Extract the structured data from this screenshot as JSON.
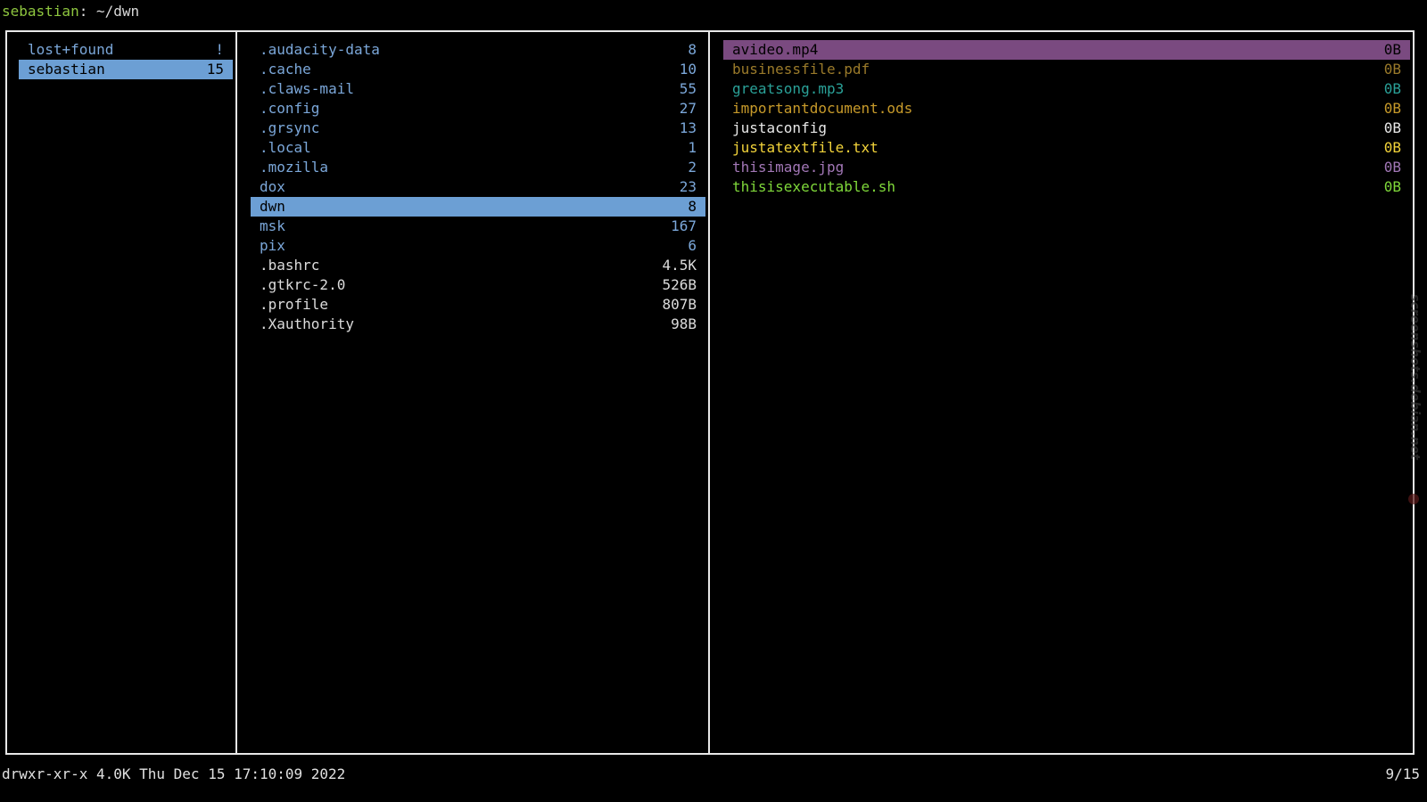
{
  "title": {
    "user": "sebastian",
    "separator": ": ",
    "path": "~/dwn"
  },
  "parent_pane": {
    "items": [
      {
        "name": "lost+found",
        "size": "!"
      },
      {
        "name": "sebastian",
        "size": "15"
      }
    ]
  },
  "current_pane": {
    "items": [
      {
        "name": ".audacity-data",
        "size": "8"
      },
      {
        "name": ".cache",
        "size": "10"
      },
      {
        "name": ".claws-mail",
        "size": "55"
      },
      {
        "name": ".config",
        "size": "27"
      },
      {
        "name": ".grsync",
        "size": "13"
      },
      {
        "name": ".local",
        "size": "1"
      },
      {
        "name": ".mozilla",
        "size": "2"
      },
      {
        "name": "dox",
        "size": "23"
      },
      {
        "name": "dwn",
        "size": "8"
      },
      {
        "name": "msk",
        "size": "167"
      },
      {
        "name": "pix",
        "size": "6"
      },
      {
        "name": ".bashrc",
        "size": "4.5K"
      },
      {
        "name": ".gtkrc-2.0",
        "size": "526B"
      },
      {
        "name": ".profile",
        "size": "807B"
      },
      {
        "name": ".Xauthority",
        "size": "98B"
      }
    ]
  },
  "preview_pane": {
    "items": [
      {
        "name": "avideo.mp4",
        "size": "0B"
      },
      {
        "name": "businessfile.pdf",
        "size": "0B"
      },
      {
        "name": "greatsong.mp3",
        "size": "0B"
      },
      {
        "name": "importantdocument.ods",
        "size": "0B"
      },
      {
        "name": "justaconfig",
        "size": "0B"
      },
      {
        "name": "justatextfile.txt",
        "size": "0B"
      },
      {
        "name": "thisimage.jpg",
        "size": "0B"
      },
      {
        "name": "thisisexecutable.sh",
        "size": "0B"
      }
    ]
  },
  "status": {
    "info": "drwxr-xr-x 4.0K Thu Dec 15 17:10:09 2022",
    "position": "9/15"
  },
  "watermark": "screenshots.debian.net",
  "colors": {
    "background": "#000000",
    "border": "#e8e8e8",
    "directory": "#7ba7d9",
    "selection_dir": "#6c9fd4",
    "selection_file": "#7a4a80",
    "user": "#8ec63f"
  }
}
